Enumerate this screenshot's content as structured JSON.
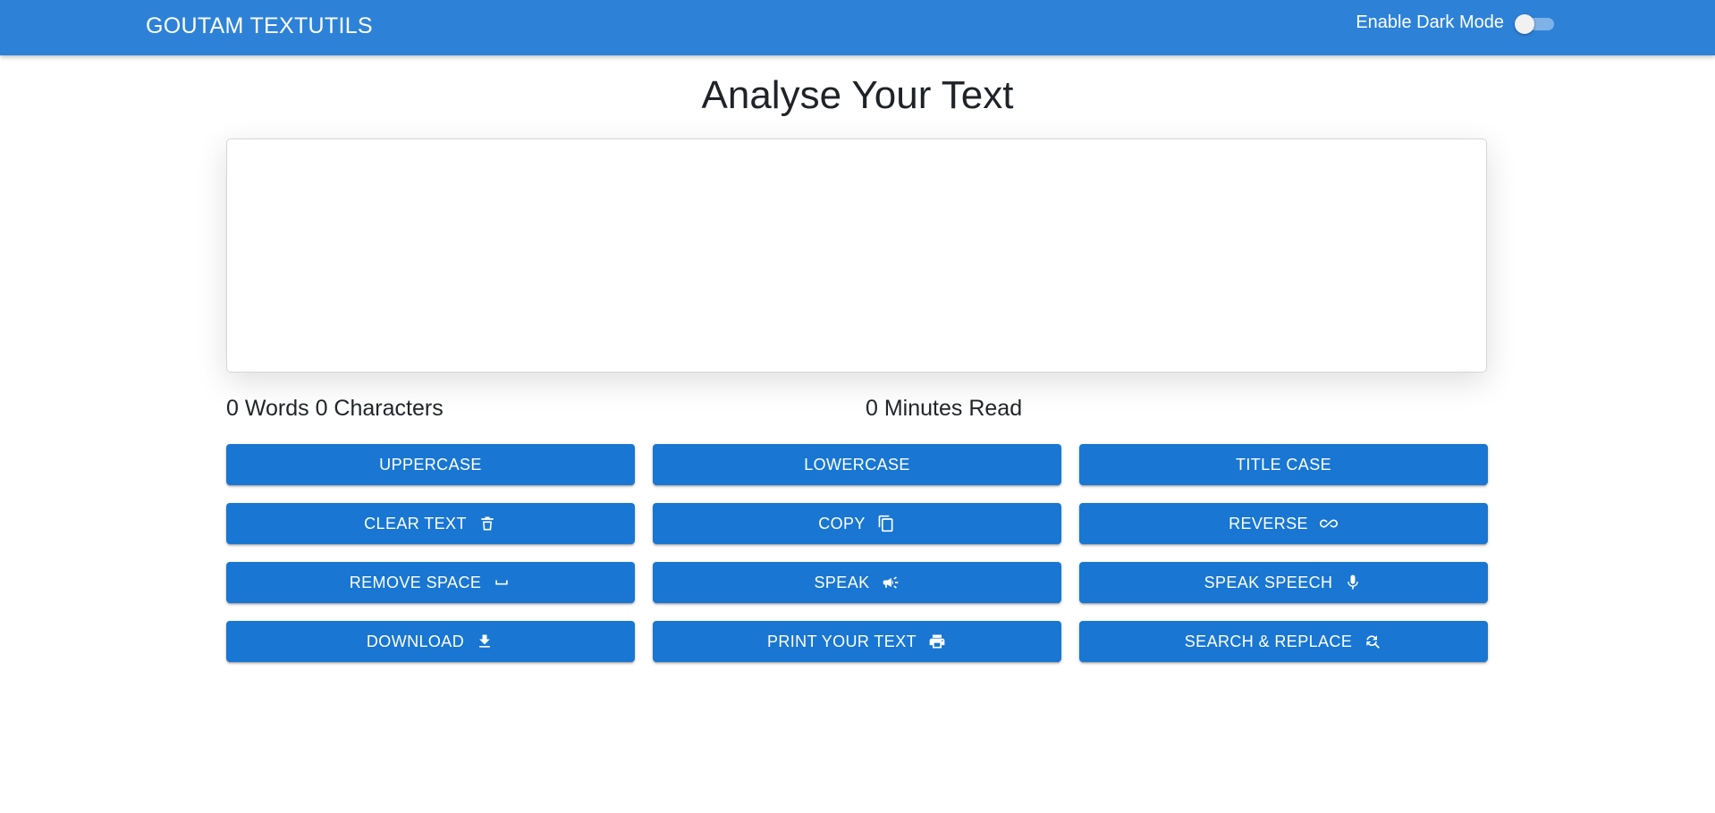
{
  "navbar": {
    "brand": "GOUTAM TEXTUTILS",
    "dark_mode_label": "Enable Dark Mode",
    "dark_mode_enabled": false
  },
  "main": {
    "title": "Analyse Your Text",
    "textarea_value": "",
    "word_count_text": "0 Words 0 Characters",
    "read_time_text": "0 Minutes Read"
  },
  "buttons": {
    "uppercase": "UPPERCASE",
    "lowercase": "LOWERCASE",
    "title_case": "TITLE CASE",
    "clear_text": "CLEAR TEXT",
    "copy": "COPY",
    "reverse": "REVERSE",
    "remove_space": "REMOVE SPACE",
    "speak": "SPEAK",
    "speak_speech": "SPEAK SPEECH",
    "download": "DOWNLOAD",
    "print": "PRINT YOUR TEXT",
    "search_replace": "SEARCH & REPLACE"
  },
  "icons": {
    "clear_text": "trash-icon",
    "copy": "copy-icon",
    "reverse": "infinity-icon",
    "remove_space": "space-bar-icon",
    "speak": "campaign-icon",
    "speak_speech": "mic-icon",
    "download": "download-icon",
    "print": "print-icon",
    "search_replace": "find-replace-icon"
  },
  "colors": {
    "navbar": "#2d82d8",
    "button": "#1976d2",
    "switch_track": "#7fb3e8"
  }
}
